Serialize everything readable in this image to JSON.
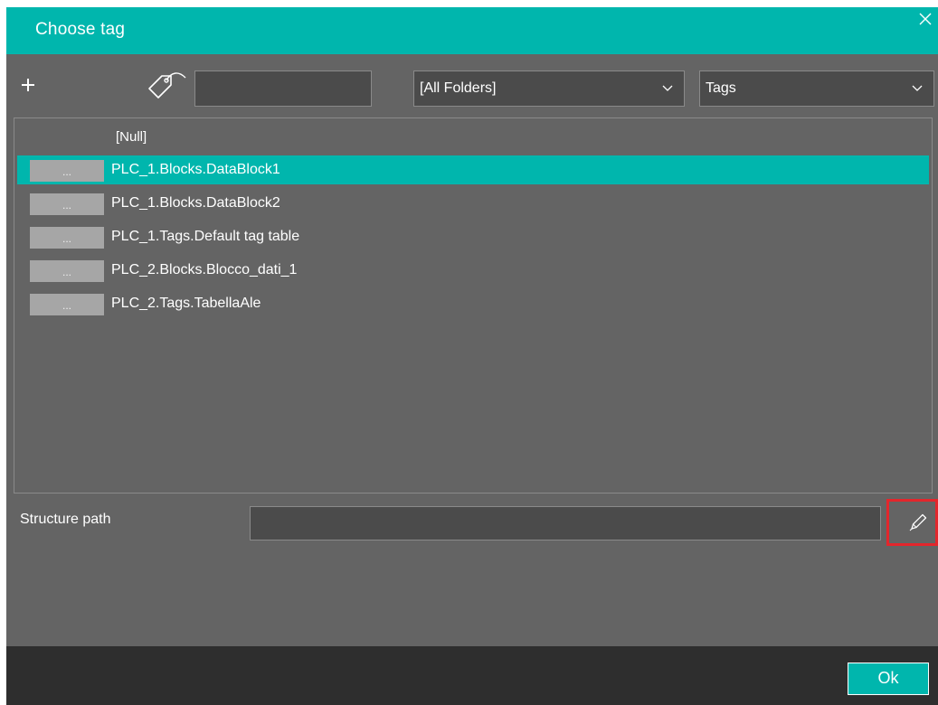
{
  "dialog": {
    "title": "Choose tag",
    "accent_color": "#00b6ad",
    "background_color": "#646464",
    "close_icon": "close-icon"
  },
  "toolbar": {
    "add_icon": "plus-icon",
    "tag_icon": "tag-icon",
    "search_value": "",
    "folder_select": {
      "selected": "[All Folders]"
    },
    "type_select": {
      "selected": "Tags"
    }
  },
  "list": {
    "null_item": "[Null]",
    "items": [
      {
        "button": "...",
        "label": "PLC_1.Blocks.DataBlock1",
        "selected": true
      },
      {
        "button": "...",
        "label": "PLC_1.Blocks.DataBlock2",
        "selected": false
      },
      {
        "button": "...",
        "label": "PLC_1.Tags.Default tag table",
        "selected": false
      },
      {
        "button": "...",
        "label": "PLC_2.Blocks.Blocco_dati_1",
        "selected": false
      },
      {
        "button": "...",
        "label": "PLC_2.Tags.TabellaAle",
        "selected": false
      }
    ]
  },
  "structure": {
    "label": "Structure path",
    "value": "",
    "edit_icon": "pencil-icon",
    "highlight_color": "#e3262c"
  },
  "footer": {
    "ok_label": "Ok"
  }
}
